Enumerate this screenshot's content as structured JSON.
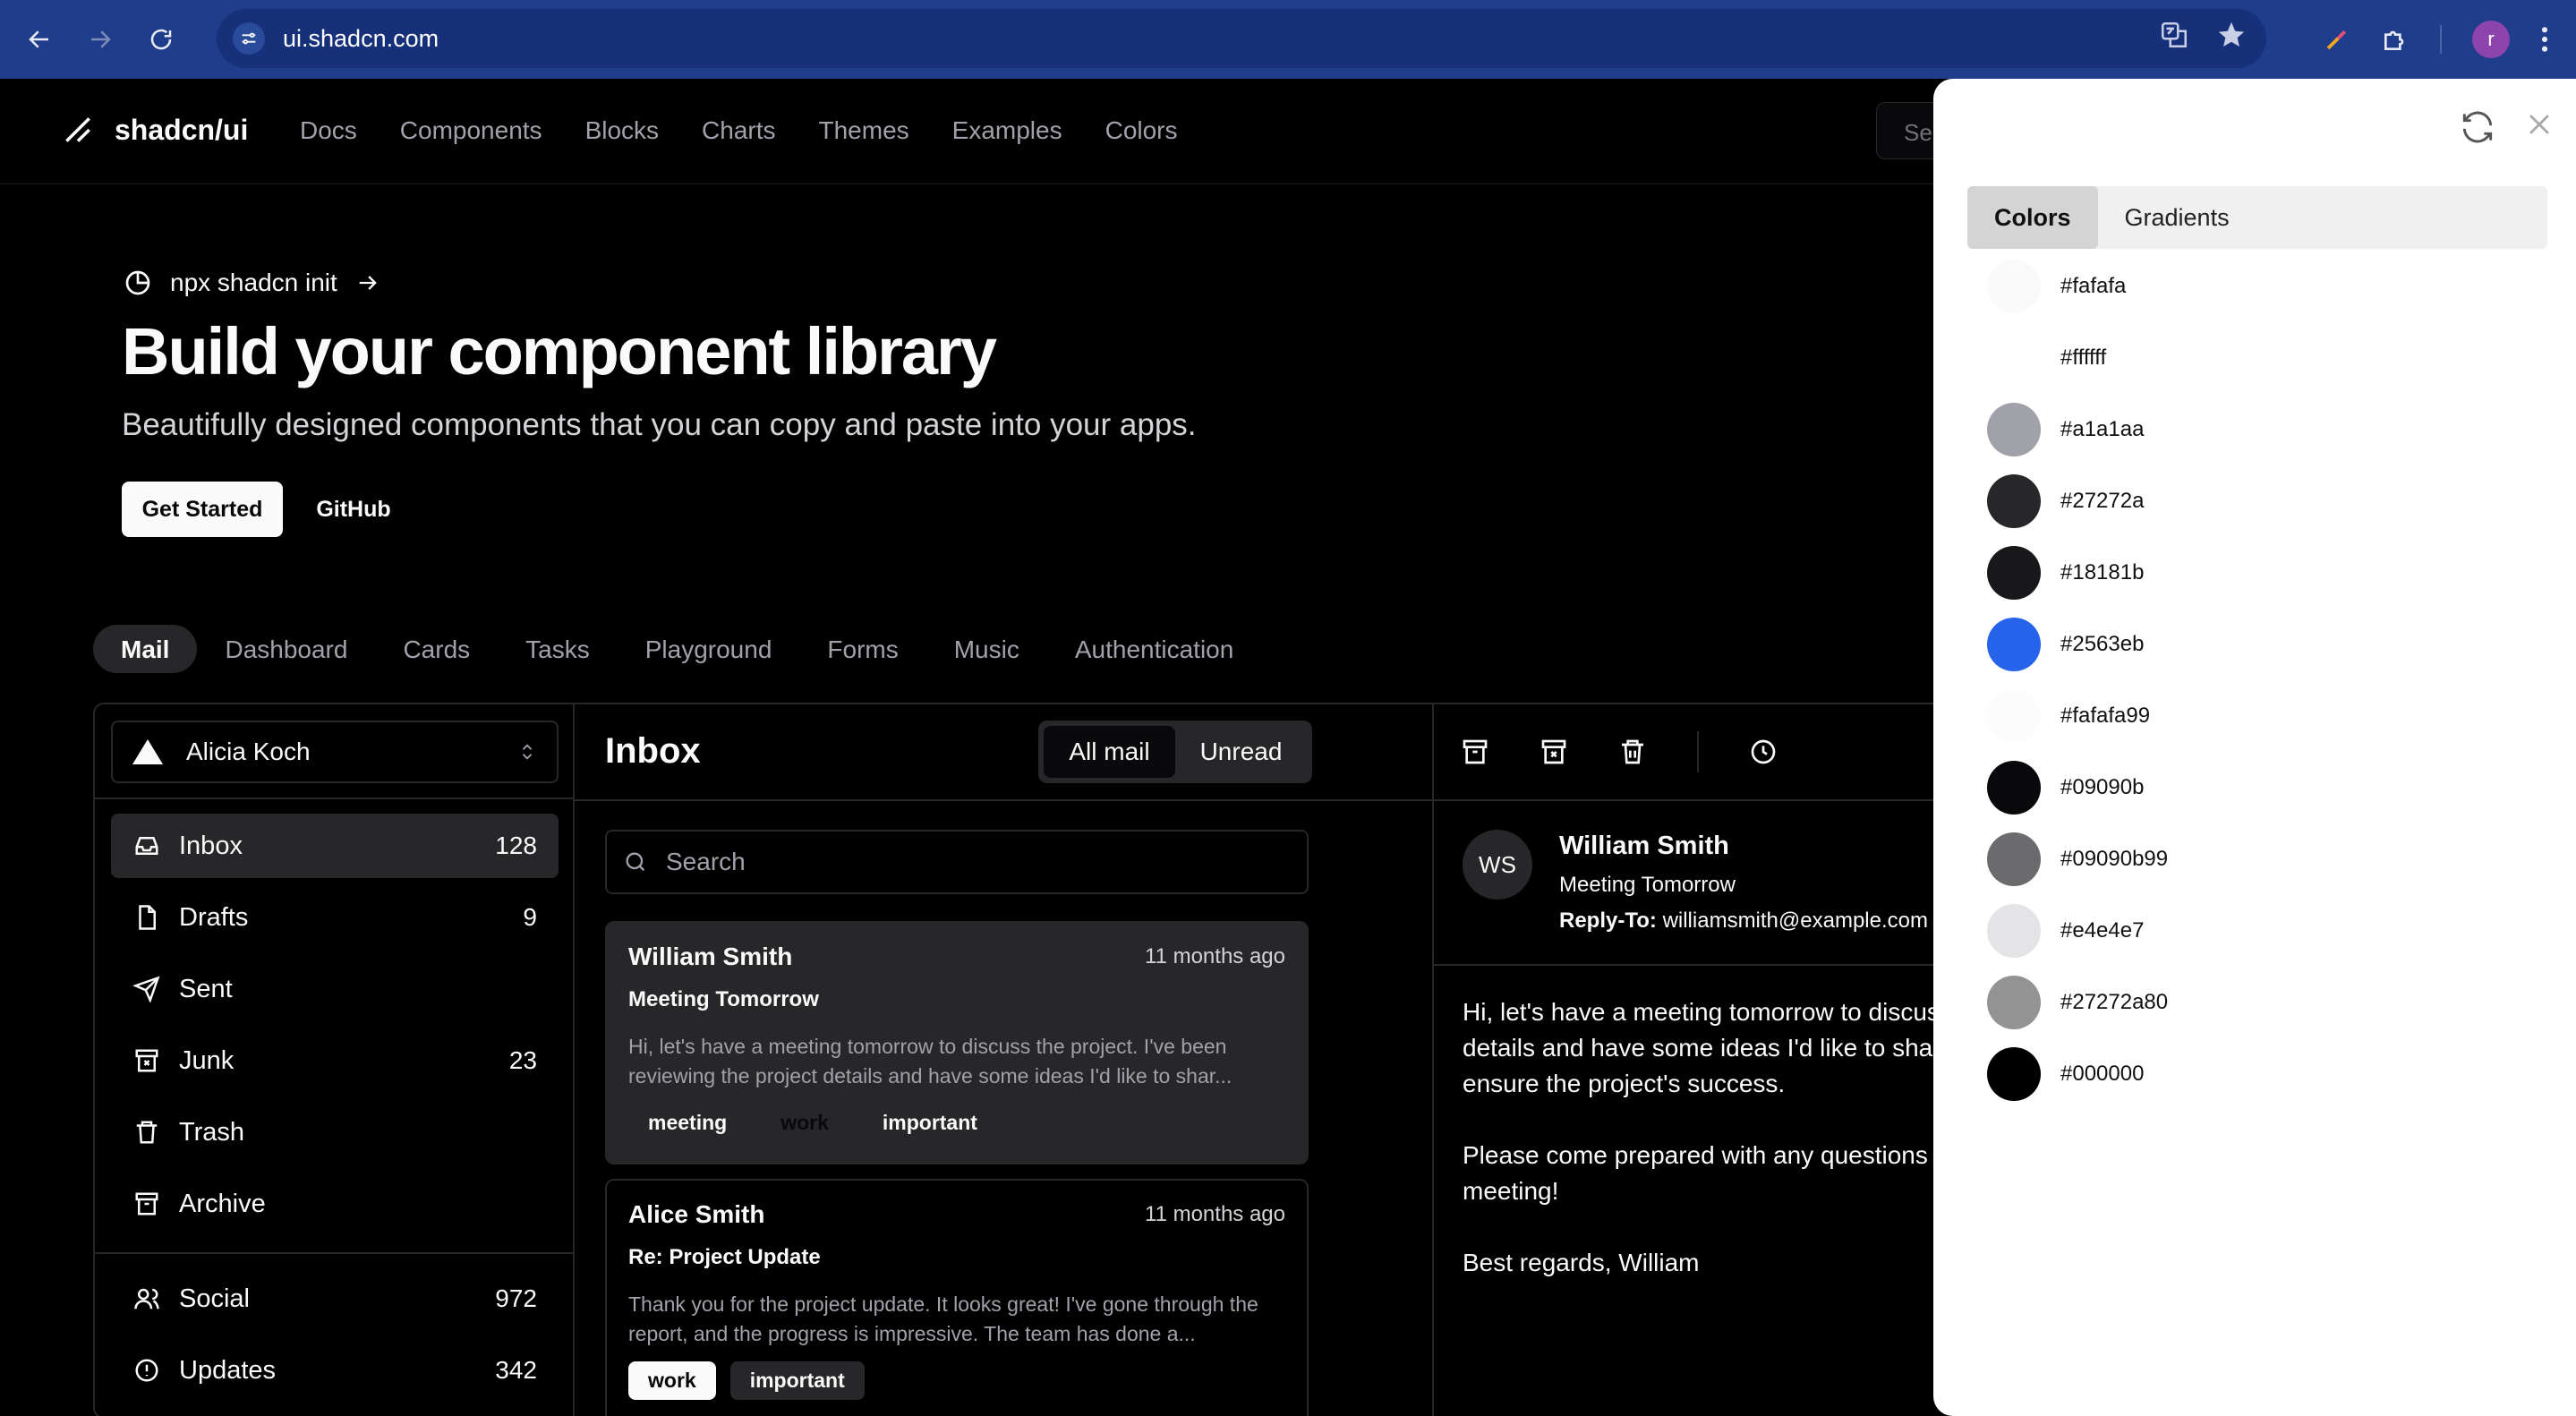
{
  "browser": {
    "url": "ui.shadcn.com",
    "profile_initial": "r"
  },
  "site": {
    "logo": "shadcn/ui",
    "nav": [
      "Docs",
      "Components",
      "Blocks",
      "Charts",
      "Themes",
      "Examples",
      "Colors"
    ],
    "search_placeholder": "Se"
  },
  "hero": {
    "announcement": "npx shadcn init",
    "title": "Build your component library",
    "subtitle": "Beautifully designed components that you can copy and paste into your apps.",
    "primary_button": "Get Started",
    "secondary_button": "GitHub"
  },
  "example_tabs": [
    "Mail",
    "Dashboard",
    "Cards",
    "Tasks",
    "Playground",
    "Forms",
    "Music",
    "Authentication"
  ],
  "mail": {
    "account": "Alicia Koch",
    "folders": [
      {
        "label": "Inbox",
        "count": "128"
      },
      {
        "label": "Drafts",
        "count": "9"
      },
      {
        "label": "Sent",
        "count": ""
      },
      {
        "label": "Junk",
        "count": "23"
      },
      {
        "label": "Trash",
        "count": ""
      },
      {
        "label": "Archive",
        "count": ""
      }
    ],
    "categories": [
      {
        "label": "Social",
        "count": "972"
      },
      {
        "label": "Updates",
        "count": "342"
      }
    ],
    "inbox_title": "Inbox",
    "filter_all": "All mail",
    "filter_unread": "Unread",
    "search_placeholder": "Search",
    "messages": [
      {
        "name": "William Smith",
        "time": "11 months ago",
        "subject": "Meeting Tomorrow",
        "preview": "Hi, let's have a meeting tomorrow to discuss the project. I've been reviewing the project details and have some ideas I'd like to shar...",
        "tags": [
          "meeting",
          "work",
          "important"
        ]
      },
      {
        "name": "Alice Smith",
        "time": "11 months ago",
        "subject": "Re: Project Update",
        "preview": "Thank you for the project update. It looks great! I've gone through the report, and the progress is impressive. The team has done a...",
        "tags": [
          "work",
          "important"
        ]
      }
    ],
    "detail": {
      "initials": "WS",
      "name": "William Smith",
      "subject": "Meeting Tomorrow",
      "reply_label": "Reply-To:",
      "reply_to": "williamsmith@example.com",
      "body": "Hi, let's have a meeting tomorrow to discuss the p\ndetails and have some ideas I'd like to share. It's c\nensure the project's success.\n\nPlease come prepared with any questions or insig\nmeeting!\n\nBest regards, William"
    }
  },
  "color_panel": {
    "tabs": [
      "Colors",
      "Gradients"
    ],
    "colors": [
      {
        "hex": "#fafafa",
        "label": "#fafafa"
      },
      {
        "hex": "#ffffff",
        "label": "#ffffff"
      },
      {
        "hex": "#a1a1aa",
        "label": "#a1a1aa"
      },
      {
        "hex": "#27272a",
        "label": "#27272a"
      },
      {
        "hex": "#18181b",
        "label": "#18181b"
      },
      {
        "hex": "#2563eb",
        "label": "#2563eb"
      },
      {
        "hex": "#fafafa99",
        "label": "#fafafa99"
      },
      {
        "hex": "#09090b",
        "label": "#09090b"
      },
      {
        "hex": "#09090b99",
        "label": "#09090b99"
      },
      {
        "hex": "#e4e4e7",
        "label": "#e4e4e7"
      },
      {
        "hex": "#27272a80",
        "label": "#27272a80"
      },
      {
        "hex": "#000000",
        "label": "#000000"
      }
    ]
  }
}
